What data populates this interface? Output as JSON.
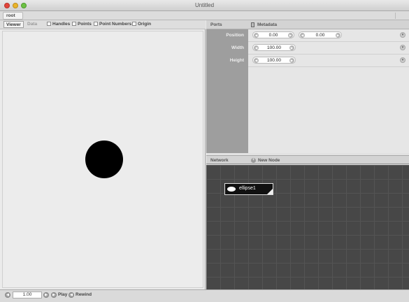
{
  "window": {
    "title": "Untitled"
  },
  "breadcrumb": {
    "root": "root"
  },
  "viewer": {
    "tabs": [
      "Viewer",
      "Data"
    ],
    "options": [
      {
        "label": "Handles",
        "checked": false
      },
      {
        "label": "Points",
        "checked": false
      },
      {
        "label": "Point Numbers",
        "checked": false
      },
      {
        "label": "Origin",
        "checked": false
      }
    ]
  },
  "ports": {
    "header": "Ports",
    "metadata": "Metadata",
    "rows": [
      {
        "label": "Position",
        "values": [
          "0.00",
          "0.00"
        ]
      },
      {
        "label": "Width",
        "values": [
          "100.00"
        ]
      },
      {
        "label": "Height",
        "values": [
          "100.00"
        ]
      }
    ]
  },
  "network": {
    "header": "Network",
    "new_node": "New Node",
    "nodes": [
      {
        "name": "ellipse1"
      }
    ]
  },
  "playback": {
    "frame": "1.00",
    "play": "Play",
    "rewind": "Rewind"
  },
  "colors": {
    "canvas": "#ececec",
    "shape": "#000000",
    "network_bg": "#474747"
  }
}
